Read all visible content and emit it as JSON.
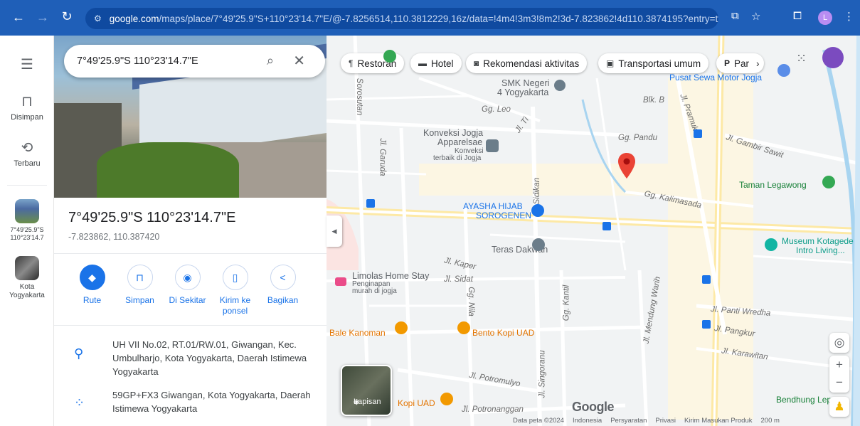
{
  "browser": {
    "url_host": "google.com",
    "url_path": "/maps/place/7°49'25.9\"S+110°23'14.7\"E/@-7.8256514,110.3812229,16z/data=!4m4!3m3!8m2!3d-7.823862!4d110.3874195?entry=ttu",
    "profile_initial": "L"
  },
  "rail": {
    "saved_label": "Disimpan",
    "recent_label": "Terbaru",
    "recent_place_label": "7°49'25.9\"S 110°23'14.7",
    "city_label": "Kota Yogyakarta"
  },
  "panel": {
    "search_value": "7°49'25.9\"S 110°23'14.7\"E",
    "title": "7°49'25.9\"S 110°23'14.7\"E",
    "coords": "-7.823862, 110.387420",
    "actions": [
      {
        "label": "Rute"
      },
      {
        "label": "Simpan"
      },
      {
        "label": "Di Sekitar"
      },
      {
        "label": "Kirim ke ponsel"
      },
      {
        "label": "Bagikan"
      }
    ],
    "address": "UH VII No.02, RT.01/RW.01, Giwangan, Kec. Umbulharjo, Kota Yogyakarta, Daerah Istimewa Yogyakarta",
    "plus_code": "59GP+FX3 Giwangan, Kota Yogyakarta, Daerah Istimewa Yogyakarta"
  },
  "chips": [
    {
      "label": "Restoran",
      "icon": "fork-knife-icon"
    },
    {
      "label": "Hotel",
      "icon": "bed-icon"
    },
    {
      "label": "Rekomendasi aktivitas",
      "icon": "camera-icon"
    },
    {
      "label": "Transportasi umum",
      "icon": "bus-icon"
    },
    {
      "label": "Par",
      "icon": "parking-icon"
    }
  ],
  "map": {
    "labels": {
      "smk": "SMK Negeri",
      "smk2": "4 Yogyakarta",
      "pusat_sewa": "Pusat Sewa Motor Jogja",
      "blk": "Blk. B",
      "gg_leo": "Gg. Leo",
      "jl_ti": "Jl. Ti",
      "konveksi": "Konveksi Jogja",
      "apparelsae": "Apparelsae",
      "konveksi_sub1": "Konveksi",
      "konveksi_sub2": "terbaik di Jogja",
      "gg_pandu": "Gg. Pandu",
      "jl_gambir": "Jl. Gambir Sawit",
      "jl_garuda": "Jl. Garuda",
      "jl_sidikan": "Jl. Sidikan",
      "taman": "Taman Legawong",
      "gg_kalimasada": "Gg. Kalimasada",
      "ayasha1": "AYASHA HIJAB",
      "ayasha2": "SOROGENEN",
      "museum1": "Museum Kotagede",
      "museum2": "Intro Living...",
      "teras": "Teras Dakwah",
      "jl_kaper": "Jl. Kaper",
      "limolas": "Limolas Home Stay",
      "limolas_sub1": "Penginapan",
      "limolas_sub2": "murah di jogja",
      "jl_sidat": "Jl. Sidat",
      "gg_nila": "Gg. Nila",
      "gg_kantil": "Gg. Kantil",
      "jl_mendung": "Jl. Mendung Warih",
      "jl_panti": "Jl. Panti Wredha",
      "jl_pangkur": "Jl. Pangkur",
      "jl_karawitan": "Jl. Karawitan",
      "bale": "Bale Kanoman",
      "bento": "Bento Kopi UAD",
      "jl_potromulyo": "Jl. Potromulyo",
      "jl_singoranu": "Jl. Singoranu",
      "kopi_uad": "Kopi UAD",
      "jl_potronanggan": "Jl. Potronanggan",
      "bendhung": "Bendhung Lepen",
      "sorosutan": "Sorosutan",
      "pramuka": "Jl. Pramuka",
      "layer_label": "Lapisan",
      "google": "Google"
    },
    "footer": [
      "Data peta ©2024",
      "Indonesia",
      "Persyaratan",
      "Privasi",
      "Kirim Masukan Produk",
      "200 m"
    ]
  }
}
